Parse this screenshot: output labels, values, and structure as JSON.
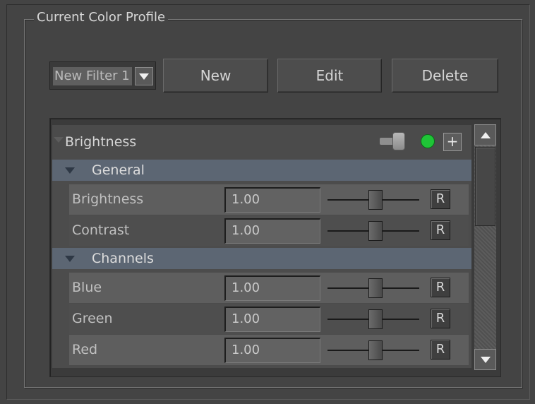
{
  "group": {
    "title": "Current Color Profile"
  },
  "toolbar": {
    "filter_select_value": "New Filter 1",
    "new_label": "New",
    "edit_label": "Edit",
    "delete_label": "Delete"
  },
  "filter": {
    "name": "Brightness",
    "enabled": true,
    "status_color": "#1fc437",
    "add_label": "+"
  },
  "sections": {
    "general": {
      "label": "General",
      "params": [
        {
          "label": "Brightness",
          "value": "1.00",
          "slider_level": 0.5,
          "reset_label": "R"
        },
        {
          "label": "Contrast",
          "value": "1.00",
          "slider_level": 0.5,
          "reset_label": "R"
        }
      ]
    },
    "channels": {
      "label": "Channels",
      "params": [
        {
          "label": "Blue",
          "value": "1.00",
          "slider_level": 0.5,
          "reset_label": "R"
        },
        {
          "label": "Green",
          "value": "1.00",
          "slider_level": 0.5,
          "reset_label": "R"
        },
        {
          "label": "Red",
          "value": "1.00",
          "slider_level": 0.5,
          "reset_label": "R"
        }
      ]
    }
  },
  "icons": [
    "dropdown-arrow-icon",
    "collapse-triangle-icon",
    "scroll-up-arrow-icon",
    "scroll-down-arrow-icon"
  ]
}
